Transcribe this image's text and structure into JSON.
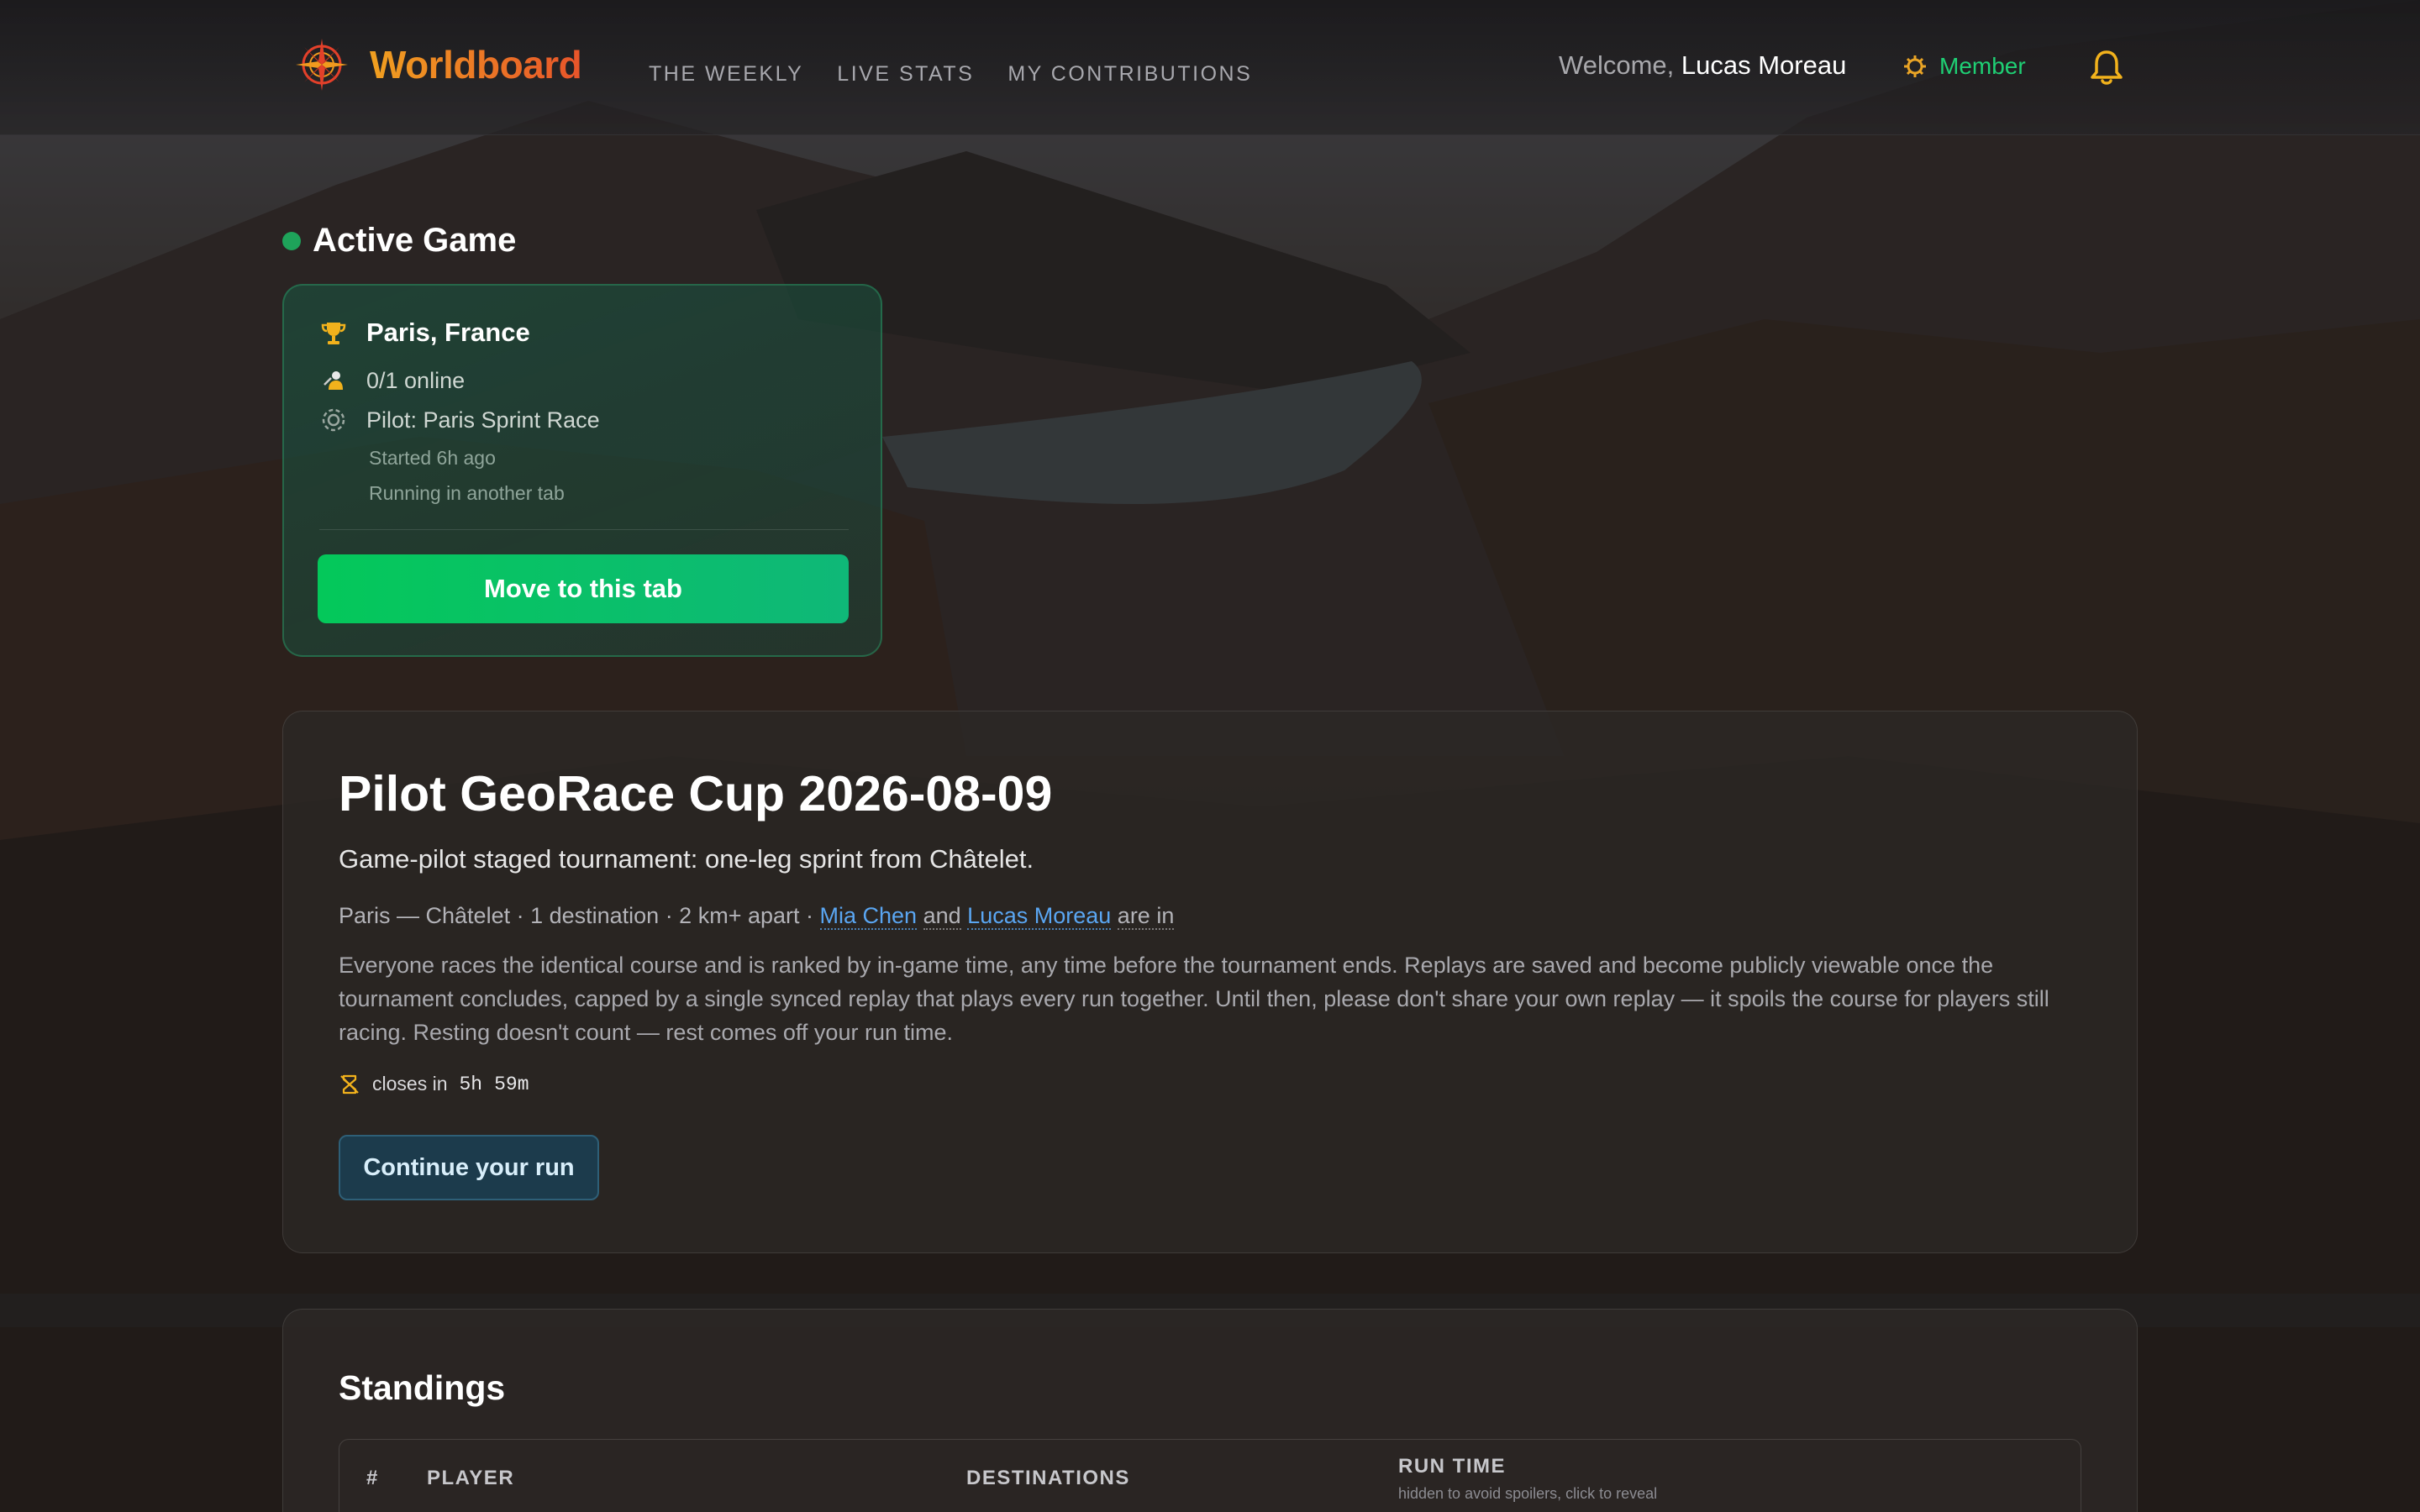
{
  "header": {
    "brand": "Worldboard",
    "nav": [
      "THE WEEKLY",
      "LIVE STATS",
      "MY CONTRIBUTIONS"
    ],
    "welcome_prefix": "Welcome,",
    "user_name": "Lucas Moreau",
    "membership": "Member"
  },
  "active_game": {
    "heading": "Active Game",
    "location": "Paris, France",
    "online": "0/1 online",
    "mode": "Pilot: Paris Sprint Race",
    "started": "Started 6h ago",
    "running": "Running in another tab",
    "action": "Move to this tab"
  },
  "tournament": {
    "title": "Pilot GeoRace Cup 2026-08-09",
    "subtitle": "Game-pilot staged tournament: one-leg sprint from Châtelet.",
    "meta_prefix": "Paris — Châtelet · 1 destination · 2 km+ apart ·",
    "participant_1": "Mia Chen",
    "and": "and",
    "participant_2": "Lucas Moreau",
    "meta_suffix": "are in",
    "description": "Everyone races the identical course and is ranked by in-game time, any time before the tournament ends. Replays are saved and become publicly viewable once the tournament concludes, capped by a single synced replay that plays every run together. Until then, please don't share your own replay — it spoils the course for players still racing. Resting doesn't count — rest comes off your run time.",
    "closes_label": "closes in",
    "closes_hours": "5h",
    "closes_minutes": "59m",
    "action": "Continue your run"
  },
  "standings": {
    "title": "Standings",
    "columns": [
      "#",
      "PLAYER",
      "DESTINATIONS",
      "RUN TIME"
    ],
    "run_time_hint": "hidden to avoid spoilers, click to reveal"
  },
  "colors": {
    "accent_green": "#04c85a",
    "member_green": "#1fcf74",
    "link_blue": "#5aa6f2",
    "brand_orange": "#f0a020",
    "bell_yellow": "#f2b21c"
  }
}
